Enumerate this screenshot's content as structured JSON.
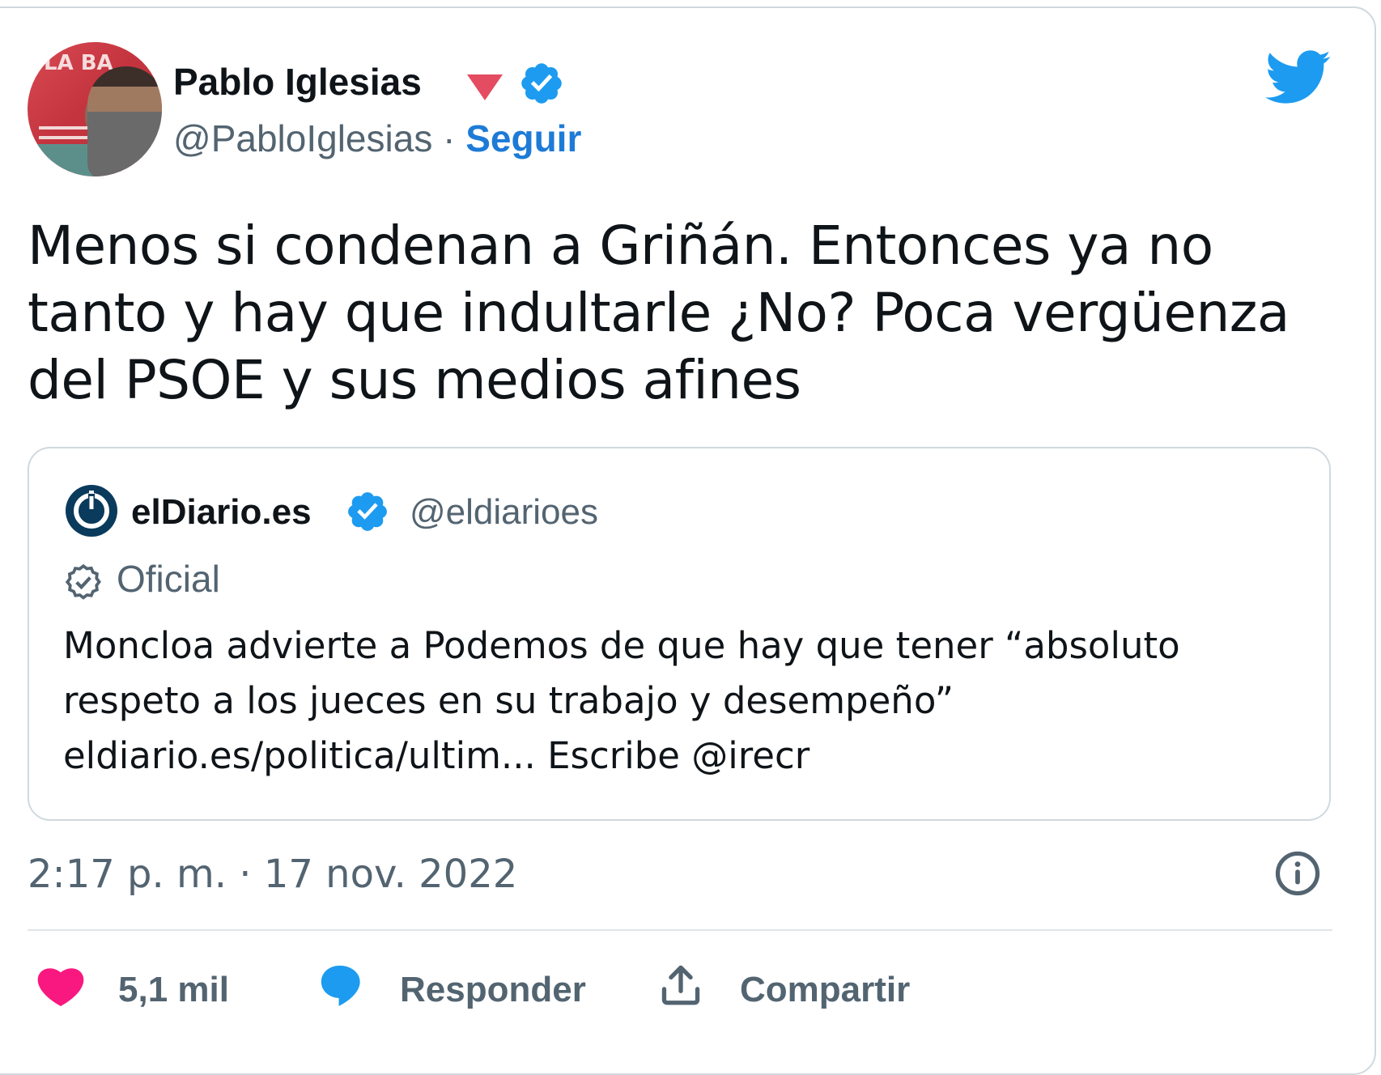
{
  "author": {
    "name": "Pablo Iglesias",
    "handle": "@PabloIglesias",
    "separator": "·",
    "follow_label": "Seguir",
    "avatar_text": "LA BA"
  },
  "tweet": {
    "text": "Menos si condenan a Griñán. Entonces ya no tanto y hay que indultarle ¿No? Poca vergüenza del PSOE y sus medios afines",
    "timestamp": "2:17 p. m. · 17 nov. 2022"
  },
  "quoted": {
    "name": "elDiario.es",
    "handle": "@eldiarioes",
    "label": "Oficial",
    "text": "Moncloa advierte a Podemos de que hay que tener “absoluto respeto a los jueces en su trabajo y desempeño” eldiario.es/politica/ultim... Escribe @irecr"
  },
  "actions": {
    "likes": "5,1 mil",
    "reply": "Responder",
    "share": "Compartir"
  },
  "colors": {
    "accent": "#1d9bf0",
    "follow": "#1d7bd7",
    "like": "#f91880",
    "muted": "#536471",
    "verified": "#1d9bf0",
    "party_triangle": "#e44c62",
    "eldiario_logo": "#0a3a5c"
  },
  "icons": [
    "verified-badge-icon",
    "party-triangle-icon",
    "twitter-bird-icon",
    "eldiario-logo-icon",
    "official-badge-icon",
    "info-icon",
    "heart-icon",
    "reply-bubble-icon",
    "share-icon"
  ]
}
